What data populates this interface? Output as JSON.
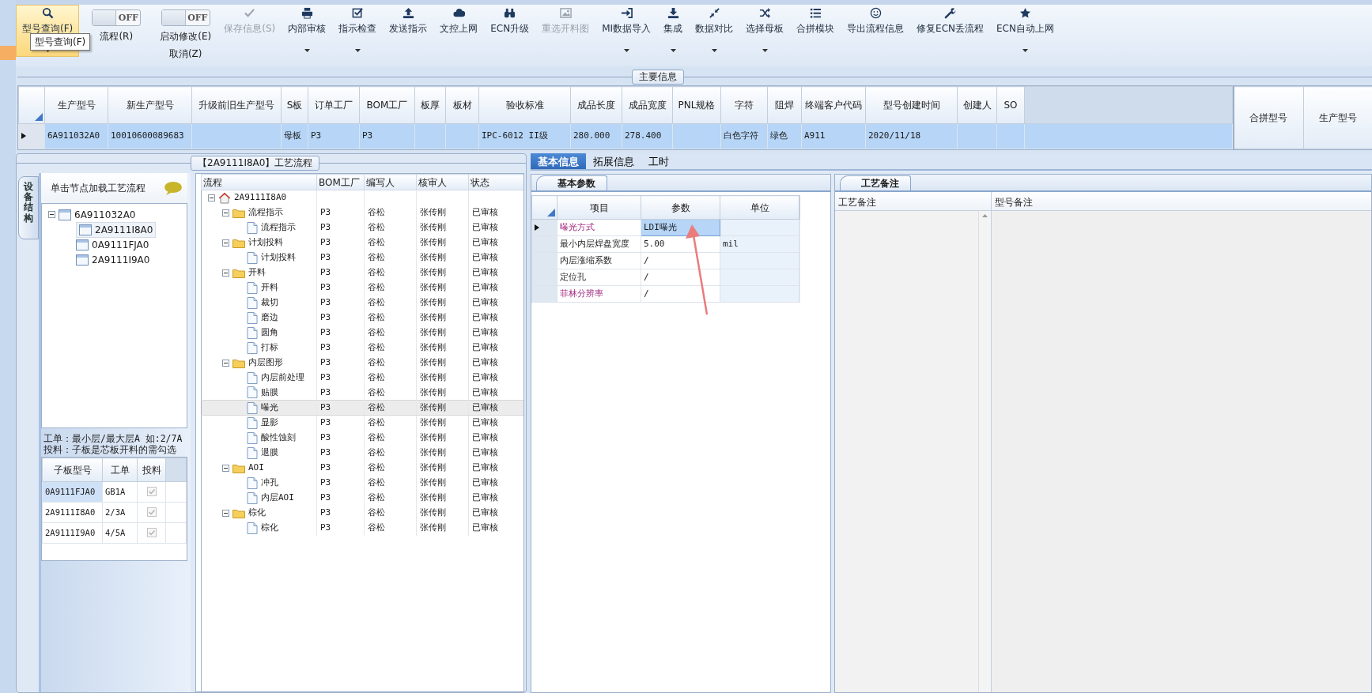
{
  "toolbar": {
    "tooltip": "型号查询(F)",
    "items": [
      {
        "kind": "button",
        "label": "型号查询(F)",
        "selected": true,
        "disabled": false,
        "dropdown": true
      },
      {
        "kind": "toggle",
        "toggle_text": "OFF",
        "on": false,
        "label": "流程(R)"
      },
      {
        "kind": "toggle",
        "toggle_text": "OFF",
        "on": false,
        "label": "启动修改(E)",
        "sublabel": "取消(Z)"
      },
      {
        "kind": "button",
        "label": "保存信息(S)",
        "selected": false,
        "disabled": true,
        "dropdown": false
      },
      {
        "kind": "button",
        "label": "内部审核",
        "selected": false,
        "disabled": false,
        "dropdown": true
      },
      {
        "kind": "button",
        "label": "指示检查",
        "selected": false,
        "disabled": false,
        "dropdown": true
      },
      {
        "kind": "button",
        "label": "发送指示",
        "selected": false,
        "disabled": false,
        "dropdown": false
      },
      {
        "kind": "button",
        "label": "文控上网",
        "selected": false,
        "disabled": false,
        "dropdown": false
      },
      {
        "kind": "button",
        "label": "ECN升级",
        "selected": false,
        "disabled": false,
        "dropdown": false
      },
      {
        "kind": "button",
        "label": "重选开料图",
        "selected": false,
        "disabled": true,
        "dropdown": false
      },
      {
        "kind": "button",
        "label": "MI数据导入",
        "selected": false,
        "disabled": false,
        "dropdown": true
      },
      {
        "kind": "button",
        "label": "集成",
        "selected": false,
        "disabled": false,
        "dropdown": true
      },
      {
        "kind": "button",
        "label": "数据对比",
        "selected": false,
        "disabled": false,
        "dropdown": true
      },
      {
        "kind": "button",
        "label": "选择母板",
        "selected": false,
        "disabled": false,
        "dropdown": true
      },
      {
        "kind": "button",
        "label": "合拼模块",
        "selected": false,
        "disabled": false,
        "dropdown": false
      },
      {
        "kind": "button",
        "label": "导出流程信息",
        "selected": false,
        "disabled": false,
        "dropdown": false
      },
      {
        "kind": "button",
        "label": "修复ECN丢流程",
        "selected": false,
        "disabled": false,
        "dropdown": false
      },
      {
        "kind": "button",
        "label": "ECN自动上网",
        "selected": false,
        "disabled": false,
        "dropdown": true
      }
    ]
  },
  "main_info": {
    "title": "主要信息",
    "columns": [
      "生产型号",
      "新生产型号",
      "升级前旧生产型号",
      "S板",
      "订单工厂",
      "BOM工厂",
      "板厚",
      "板材",
      "验收标准",
      "成品长度",
      "成品宽度",
      "PNL规格",
      "字符",
      "阻焊",
      "终端客户代码",
      "型号创建时间",
      "创建人",
      "SO"
    ],
    "rows": [
      {
        "selected": true,
        "cells": [
          "6A911032A0",
          "10010600089683",
          null,
          "母板",
          "P3",
          "P3",
          null,
          null,
          "IPC-6012 II级",
          "280.000",
          "278.400",
          null,
          "白色字符",
          "绿色",
          "A911",
          "2020/11/18",
          null,
          null
        ]
      }
    ]
  },
  "merge_table": {
    "columns": [
      "合拼型号",
      "生产型号"
    ]
  },
  "device_panel": {
    "tab_label": "设备结构",
    "hint": "单击节点加载工艺流程",
    "tree": [
      {
        "label": "6A911032A0",
        "expanded": true,
        "selected": false,
        "children": [
          {
            "label": "2A9111I8A0",
            "selected": true
          },
          {
            "label": "0A9111FJA0",
            "selected": false
          },
          {
            "label": "2A9111I9A0",
            "selected": false
          }
        ]
      }
    ],
    "notes": [
      "工单：最小层/最大层A 如:2/7A",
      "投料：子板是芯板开料的需勾选"
    ],
    "sub_table": {
      "columns": [
        "子板型号",
        "工单",
        "投料"
      ],
      "rows": [
        {
          "cells": [
            "0A9111FJA0",
            "GB1A"
          ],
          "checked": true,
          "selected": true
        },
        {
          "cells": [
            "2A9111I8A0",
            "2/3A"
          ],
          "checked": true,
          "selected": false
        },
        {
          "cells": [
            "2A9111I9A0",
            "4/5A"
          ],
          "checked": true,
          "selected": false
        }
      ]
    }
  },
  "process_flow": {
    "title": "【2A9111I8A0】工艺流程",
    "columns": [
      "流程",
      "BOM工厂",
      "编写人",
      "核审人",
      "状态"
    ],
    "tree": [
      {
        "label": "2A9111I8A0",
        "expanded": true,
        "selected": false,
        "children": [
          {
            "label": "流程指示",
            "bom": "P3",
            "writer": "谷松",
            "reviewer": "张传刚",
            "status": "已审核",
            "expanded": true,
            "selected": false,
            "children": [
              {
                "label": "流程指示",
                "bom": "P3",
                "writer": "谷松",
                "reviewer": "张传刚",
                "status": "已审核",
                "selected": false
              }
            ]
          },
          {
            "label": "计划投料",
            "bom": "P3",
            "writer": "谷松",
            "reviewer": "张传刚",
            "status": "已审核",
            "expanded": true,
            "selected": false,
            "children": [
              {
                "label": "计划投料",
                "bom": "P3",
                "writer": "谷松",
                "reviewer": "张传刚",
                "status": "已审核",
                "selected": false
              }
            ]
          },
          {
            "label": "开料",
            "bom": "P3",
            "writer": "谷松",
            "reviewer": "张传刚",
            "status": "已审核",
            "expanded": true,
            "selected": false,
            "children": [
              {
                "label": "开料",
                "bom": "P3",
                "writer": "谷松",
                "reviewer": "张传刚",
                "status": "已审核",
                "selected": false
              },
              {
                "label": "裁切",
                "bom": "P3",
                "writer": "谷松",
                "reviewer": "张传刚",
                "status": "已审核",
                "selected": false
              },
              {
                "label": "磨边",
                "bom": "P3",
                "writer": "谷松",
                "reviewer": "张传刚",
                "status": "已审核",
                "selected": false
              },
              {
                "label": "圆角",
                "bom": "P3",
                "writer": "谷松",
                "reviewer": "张传刚",
                "status": "已审核",
                "selected": false
              },
              {
                "label": "打标",
                "bom": "P3",
                "writer": "谷松",
                "reviewer": "张传刚",
                "status": "已审核",
                "selected": false
              }
            ]
          },
          {
            "label": "内层图形",
            "bom": "P3",
            "writer": "谷松",
            "reviewer": "张传刚",
            "status": "已审核",
            "expanded": true,
            "selected": false,
            "children": [
              {
                "label": "内层前处理",
                "bom": "P3",
                "writer": "谷松",
                "reviewer": "张传刚",
                "status": "已审核",
                "selected": false
              },
              {
                "label": "贴膜",
                "bom": "P3",
                "writer": "谷松",
                "reviewer": "张传刚",
                "status": "已审核",
                "selected": false
              },
              {
                "label": "曝光",
                "bom": "P3",
                "writer": "谷松",
                "reviewer": "张传刚",
                "status": "已审核",
                "selected": true
              },
              {
                "label": "显影",
                "bom": "P3",
                "writer": "谷松",
                "reviewer": "张传刚",
                "status": "已审核",
                "selected": false
              },
              {
                "label": "酸性蚀刻",
                "bom": "P3",
                "writer": "谷松",
                "reviewer": "张传刚",
                "status": "已审核",
                "selected": false
              },
              {
                "label": "退膜",
                "bom": "P3",
                "writer": "谷松",
                "reviewer": "张传刚",
                "status": "已审核",
                "selected": false
              }
            ]
          },
          {
            "label": "AOI",
            "bom": "P3",
            "writer": "谷松",
            "reviewer": "张传刚",
            "status": "已审核",
            "expanded": true,
            "selected": false,
            "children": [
              {
                "label": "冲孔",
                "bom": "P3",
                "writer": "谷松",
                "reviewer": "张传刚",
                "status": "已审核",
                "selected": false
              },
              {
                "label": "内层AOI",
                "bom": "P3",
                "writer": "谷松",
                "reviewer": "张传刚",
                "status": "已审核",
                "selected": false
              }
            ]
          },
          {
            "label": "棕化",
            "bom": "P3",
            "writer": "谷松",
            "reviewer": "张传刚",
            "status": "已审核",
            "expanded": true,
            "selected": false,
            "children": [
              {
                "label": "棕化",
                "bom": "P3",
                "writer": "谷松",
                "reviewer": "张传刚",
                "status": "已审核",
                "selected": false
              }
            ]
          }
        ]
      }
    ]
  },
  "detail_tabs": [
    {
      "label": "基本信息",
      "selected": true
    },
    {
      "label": "拓展信息",
      "selected": false
    },
    {
      "label": "工时",
      "selected": false
    }
  ],
  "basic_params": {
    "tab_label": "基本参数",
    "columns": [
      "项目",
      "参数",
      "单位"
    ],
    "rows": [
      {
        "item": "曝光方式",
        "value": "LDI曝光",
        "emphasis": true,
        "selected": true
      },
      {
        "item": "最小内层焊盘宽度",
        "value": "5.00",
        "unit": "mil",
        "emphasis": false,
        "selected": false
      },
      {
        "item": "内层涨缩系数",
        "value": "/",
        "emphasis": false,
        "selected": false
      },
      {
        "item": "定位孔",
        "value": "/",
        "emphasis": false,
        "selected": false
      },
      {
        "item": "菲林分辨率",
        "value": "/",
        "emphasis": true,
        "selected": false
      }
    ]
  },
  "process_notes": {
    "tab_label": "工艺备注",
    "columns": [
      "工艺备注",
      "型号备注"
    ]
  }
}
